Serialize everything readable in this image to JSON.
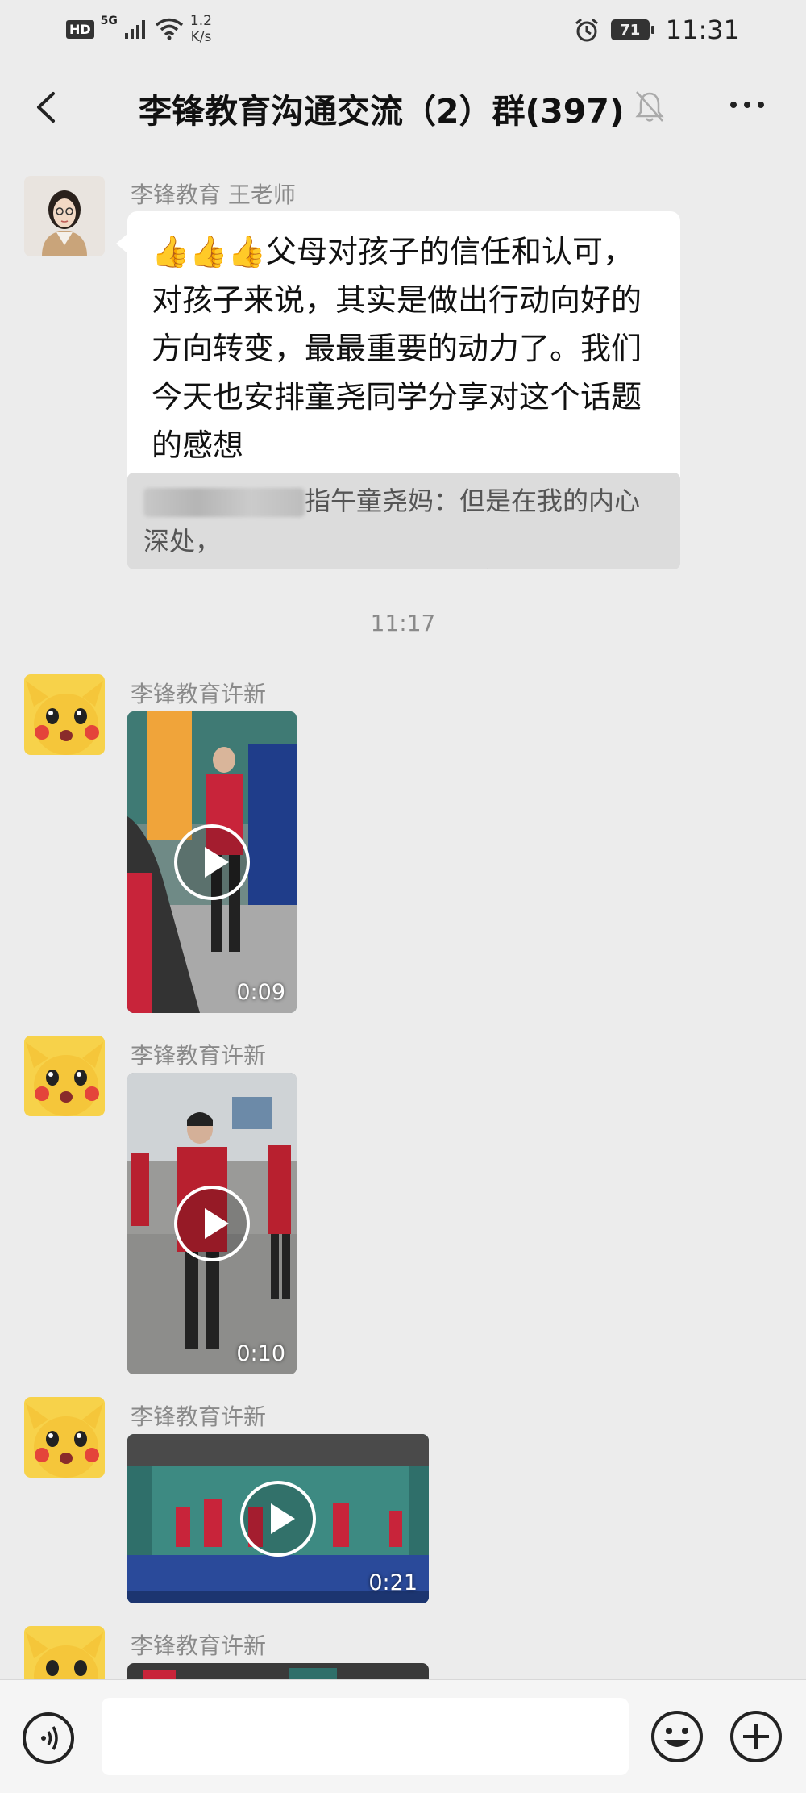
{
  "status_bar": {
    "hd": "HD",
    "network": "5G",
    "speed_top": "1.2",
    "speed_bottom": "K/s",
    "battery": "71",
    "time": "11:31"
  },
  "header": {
    "title": "李锋教育沟通交流（2）群(397)"
  },
  "messages": [
    {
      "sender": "李锋教育 王老师",
      "text_line1": "父母对孩子的信任和认可，",
      "text_rest": "对孩子来说，其实是做出行动向好的方向转变，最最重要的动力了。我们今天也安排童尧同学分享对这个话题的感想",
      "emoji": "👍👍👍",
      "quote_line1": "指午童尧妈：但是在我的内心深处，",
      "quote_line2": "我还是相信他的，他学习那么刻苦，所…"
    }
  ],
  "timestamp": "11:17",
  "videos": [
    {
      "sender": "李锋教育许新",
      "duration": "0:09"
    },
    {
      "sender": "李锋教育许新",
      "duration": "0:10"
    },
    {
      "sender": "李锋教育许新",
      "duration": "0:21"
    },
    {
      "sender": "李锋教育许新"
    }
  ],
  "icons": [
    "back-icon",
    "bell-muted-icon",
    "more-icon",
    "voice-icon",
    "emoji-icon",
    "plus-icon",
    "play-icon"
  ],
  "colors": {
    "background": "#ececec",
    "bubble": "#ffffff",
    "quote": "#dcdcdc",
    "meta_text": "#8a8a8a"
  }
}
